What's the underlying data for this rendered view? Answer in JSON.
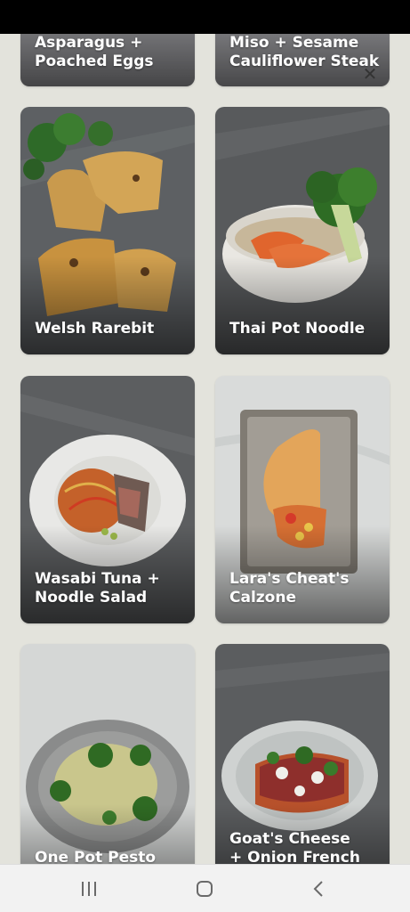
{
  "recipes": [
    {
      "title": "Asparagus +\nPoached Eggs"
    },
    {
      "title": "Miso + Sesame\nCauliflower Steak"
    },
    {
      "title": "Welsh Rarebit"
    },
    {
      "title": "Thai Pot Noodle"
    },
    {
      "title": "Wasabi Tuna +\nNoodle Salad"
    },
    {
      "title": "Lara's Cheat's\nCalzone"
    },
    {
      "title": "One Pot Pesto\nPasta"
    },
    {
      "title": "Goat's Cheese\n+ Onion French\nToast"
    }
  ],
  "overlay": {
    "close_icon": "close-icon"
  },
  "nav": {
    "recent_icon": "recent-apps-icon",
    "home_icon": "home-icon",
    "back_icon": "back-icon"
  }
}
